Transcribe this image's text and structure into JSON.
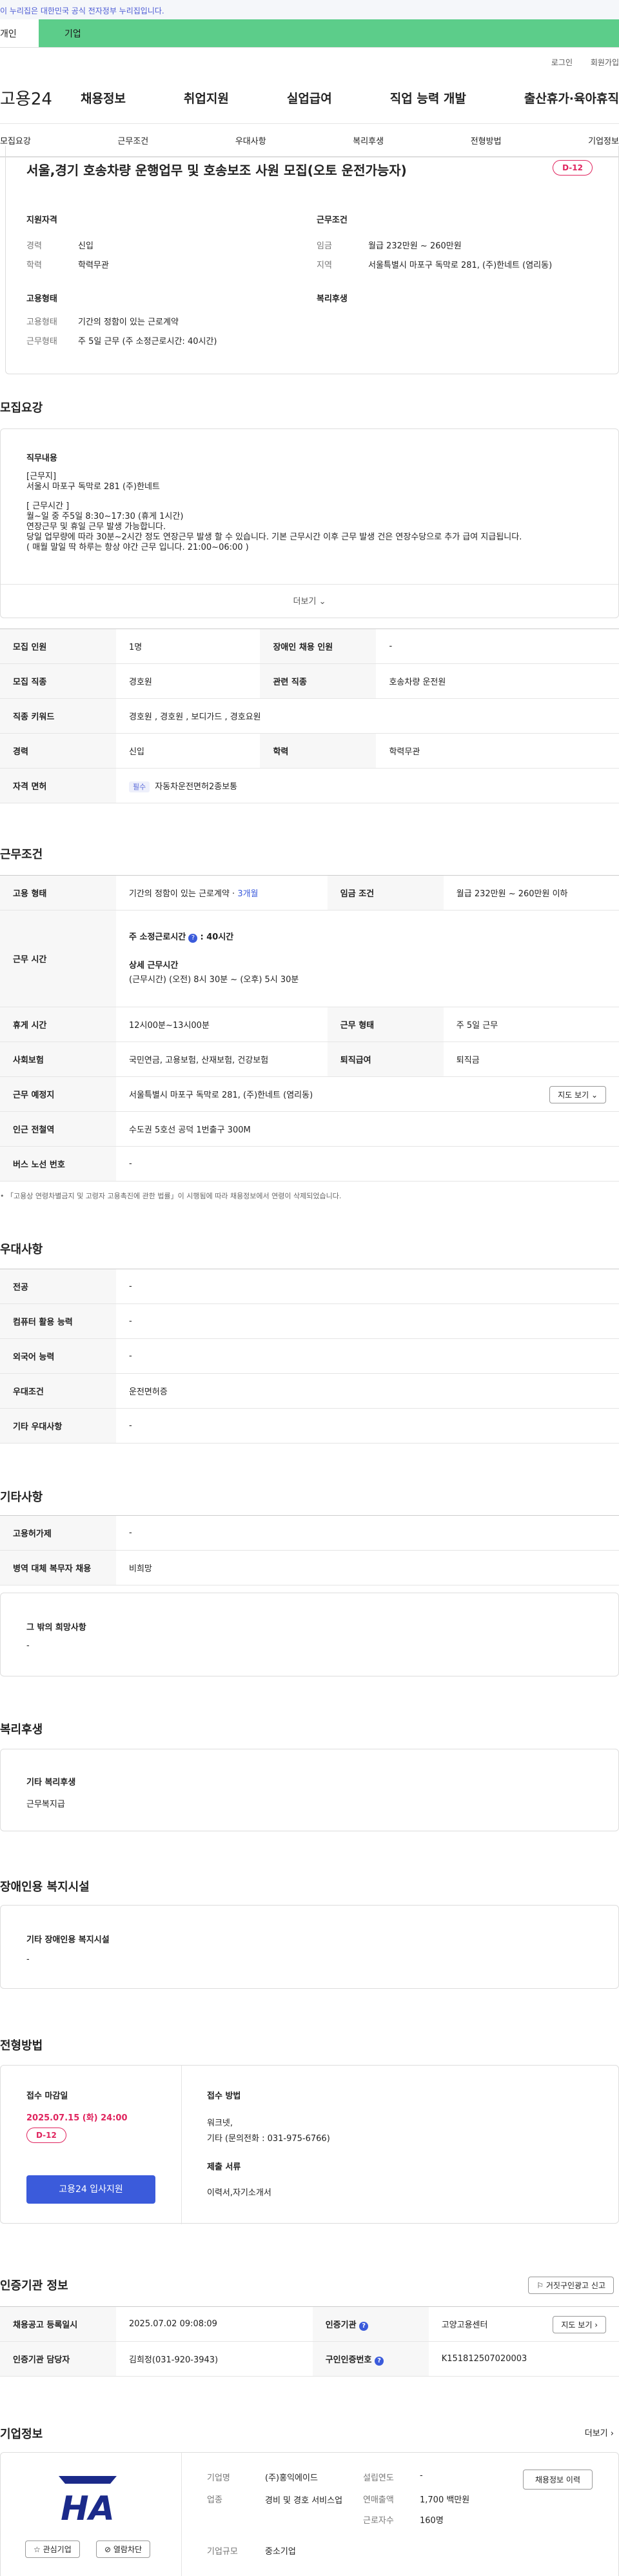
{
  "gov_banner": "이 누리집은 대한민국 공식 전자정부 누리집입니다.",
  "tabs": {
    "person": "개인",
    "company": "기업"
  },
  "util": {
    "login": "로그인",
    "join": "회원가입"
  },
  "gnb": {
    "logo": "고용24",
    "menu": [
      "채용정보",
      "취업지원",
      "실업급여",
      "직업 능력 개발",
      "출산휴가·육아휴직"
    ]
  },
  "subnav": [
    "모집요강",
    "근무조건",
    "우대사항",
    "복리후생",
    "전형방법",
    "기업정보"
  ],
  "job": {
    "title": "서울,경기 호송차량 운행업무 및 호송보조 사원 모집(오토 운전가능자)",
    "dday": "D-12",
    "qual_head": "지원자격",
    "career_label": "경력",
    "career": "신입",
    "edu_label": "학력",
    "edu": "학력무관",
    "cond_head": "근무조건",
    "wage_label": "임금",
    "wage": "월급 232만원 ~ 260만원",
    "area_label": "지역",
    "area": "서울특별시 마포구 독막로 281, (주)한네트 (염리동)",
    "type_head": "고용형태",
    "emp_label": "고용형태",
    "emp": "기간의 정함이 있는 근로계약",
    "work_label": "근무형태",
    "work": "주 5일 근무 (주 소정근로시간: 40시간)",
    "welfare_head": "복리후생"
  },
  "recruit": {
    "title": "모집요강",
    "duty_head": "직무내용",
    "duty_lines": [
      "[근무지]",
      "서울시 마포구 독막로 281 (주)한네트",
      "",
      "[ 근무시간 ]",
      "월~일 중 주5일 8:30~17:30 (휴게 1시간)",
      "연장근무 및 휴일 근무 발생 가능합니다.",
      "당일 업무량에 따라 30분~2시간 정도 연장근무 발생 할 수 있습니다. 기본 근무시간 이후 근무 발생 건은 연장수당으로 추가 급여 지급됩니다.",
      "( 매월 말일 딱 하루는 항상 야간 근무 입니다. 21:00~06:00 )"
    ],
    "more": "더보기",
    "rows": [
      [
        "모집 인원",
        "1명",
        "장애인 채용 인원",
        "-"
      ],
      [
        "모집 직종",
        "경호원",
        "관련 직종",
        "호송차량 운전원"
      ],
      [
        "직종 키워드",
        "경호원 , 경호원 , 보디가드 , 경호요원"
      ],
      [
        "경력",
        "신입",
        "학력",
        "학력무관"
      ]
    ],
    "license_label": "자격 면허",
    "license_badge": "필수",
    "license": "자동차운전면허2종보통"
  },
  "condition": {
    "title": "근무조건",
    "emp_label": "고용 형태",
    "emp": "기간의 정함이 있는 근로계약 · ",
    "emp_months": "3개월",
    "wage_label": "임금 조건",
    "wage": "월급 232만원 ~ 260만원 이하",
    "time_label": "근무 시간",
    "weekly": "주 소정근로시간",
    "weekly_val": ": 40시간",
    "detail_head": "상세 근무시간",
    "detail": "(근무시간) (오전) 8시 30분 ~ (오후) 5시 30분",
    "rest_label": "휴게 시간",
    "rest": "12시00분~13시00분",
    "shape_label": "근무 형태",
    "shape": "주 5일 근무",
    "ins_label": "사회보험",
    "ins": "국민연금, 고용보험, 산재보험, 건강보험",
    "sev_label": "퇴직급여",
    "sev": "퇴직금",
    "place_label": "근무 예정지",
    "place": "서울특별시 마포구 독막로 281, (주)한네트 (염리동)",
    "map_btn": "지도 보기",
    "station_label": "인근 전철역",
    "station": "수도권 5호선 공덕 1번출구 300M",
    "bus_label": "버스 노선 번호",
    "bus": "-",
    "note": "「고용상 연령차별금지 및 고령자 고용촉진에 관한 법률」이 시행됨에 따라 채용정보에서 연령이 삭제되었습니다."
  },
  "prefer": {
    "title": "우대사항",
    "rows": [
      [
        "전공",
        "-"
      ],
      [
        "컴퓨터 활용 능력",
        "-"
      ],
      [
        "외국어 능력",
        "-"
      ],
      [
        "우대조건",
        "운전면허증"
      ],
      [
        "기타 우대사항",
        "-"
      ]
    ]
  },
  "etc": {
    "title": "기타사항",
    "rows": [
      [
        "고용허가제",
        "-"
      ],
      [
        "병역 대체 복무자 채용",
        "비희망"
      ]
    ],
    "other_head": "그 밖의 희망사항",
    "other": "-"
  },
  "welfare": {
    "title": "복리후생",
    "head": "기타 복리후생",
    "value": "근무복지급"
  },
  "disabled": {
    "title": "장애인용 복지시설",
    "head": "기타 장애인용 복지시설",
    "value": "-"
  },
  "process": {
    "title": "전형방법",
    "deadline_head": "접수 마감일",
    "deadline": "2025.07.15 (화) 24:00",
    "dday": "D-12",
    "apply_btn": "고용24 입사지원",
    "method_head": "접수 방법",
    "method1": "워크넷,",
    "method2": "기타 (문의전화 : 031-975-6766)",
    "docs_head": "제출 서류",
    "docs": "이력서,자기소개서"
  },
  "certify": {
    "title": "인증기관 정보",
    "report_btn": "거짓구인광고 신고",
    "reg_label": "채용공고 등록일시",
    "reg": "2025.07.02 09:08:09",
    "org_label": "인증기관",
    "org": "고양고용센터",
    "map_btn": "지도 보기",
    "mgr_label": "인증기관 담당자",
    "mgr": "김희정(031-920-3943)",
    "num_label": "구인인증번호",
    "num": "K151812507020003"
  },
  "company": {
    "title": "기업정보",
    "more": "더보기",
    "logo_text": "HA",
    "fav_btn": "관심기업",
    "follow_btn": "열람차단",
    "name_label": "기업명",
    "name": "(주)홍익에이드",
    "ind_label": "업종",
    "ind": "경비 및 경호 서비스업",
    "size_label": "기업규모",
    "size": "중소기업",
    "year_label": "설립연도",
    "year": "-",
    "sales_label": "연매출액",
    "sales": "1,700 백만원",
    "staff_label": "근로자수",
    "staff": "160명",
    "info_btn": "채용정보 이력"
  },
  "colors": {
    "accent": "#e0245e",
    "green": "#5ccd8a",
    "blue": "#3b5bdb"
  }
}
